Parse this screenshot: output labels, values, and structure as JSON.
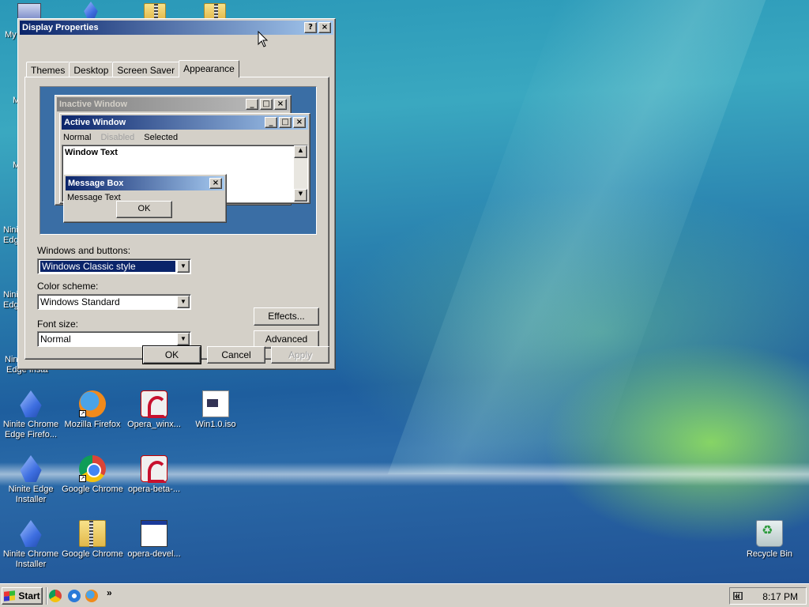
{
  "desktop": {
    "icons": [
      {
        "label": "My",
        "icon": "computer-icon"
      },
      {
        "label": "Ninite Chrome Edge Firefo...",
        "icon": "ninite-icon"
      },
      {
        "label": "Mozilla Firefox",
        "icon": "firefox-icon"
      },
      {
        "label": "Opera_winx...",
        "icon": "opera-installer-icon"
      },
      {
        "label": "Win1.0.iso",
        "icon": "iso-file-icon"
      },
      {
        "label": "Ninite Edge Installer",
        "icon": "ninite-icon"
      },
      {
        "label": "Google Chrome",
        "icon": "chrome-icon"
      },
      {
        "label": "opera-beta-...",
        "icon": "opera-installer-icon"
      },
      {
        "label": "Ninite Chrome Installer",
        "icon": "ninite-icon"
      },
      {
        "label": "Google Chrome",
        "icon": "zip-folder-icon"
      },
      {
        "label": "opera-devel...",
        "icon": "application-window-icon"
      },
      {
        "label": "Recycle Bin",
        "icon": "recycle-bin-icon"
      }
    ],
    "partial_labels": [
      "M",
      "M",
      "Nini",
      "Edg",
      "Nini",
      "Edg",
      "Nini",
      "Edge Insta"
    ]
  },
  "dialog": {
    "title": "Display Properties",
    "help_btn": "?",
    "close_btn": "×",
    "tabs": [
      "Themes",
      "Desktop",
      "Screen Saver",
      "Appearance"
    ],
    "active_tab": "Appearance",
    "preview": {
      "inactive_title": "Inactive Window",
      "active_title": "Active Window",
      "menu": [
        "Normal",
        "Disabled",
        "Selected"
      ],
      "window_text": "Window Text",
      "msgbox_title": "Message Box",
      "msgbox_text": "Message Text",
      "msgbox_ok": "OK"
    },
    "windows_buttons_label": "Windows and buttons:",
    "windows_buttons_value": "Windows Classic style",
    "color_scheme_label": "Color scheme:",
    "color_scheme_value": "Windows Standard",
    "font_size_label": "Font size:",
    "font_size_value": "Normal",
    "effects_btn": "Effects...",
    "advanced_btn": "Advanced",
    "ok_btn": "OK",
    "cancel_btn": "Cancel",
    "apply_btn": "Apply"
  },
  "taskbar": {
    "start_label": "Start",
    "chevron": "»",
    "tray_chevron": "«",
    "clock": "8:17 PM"
  }
}
